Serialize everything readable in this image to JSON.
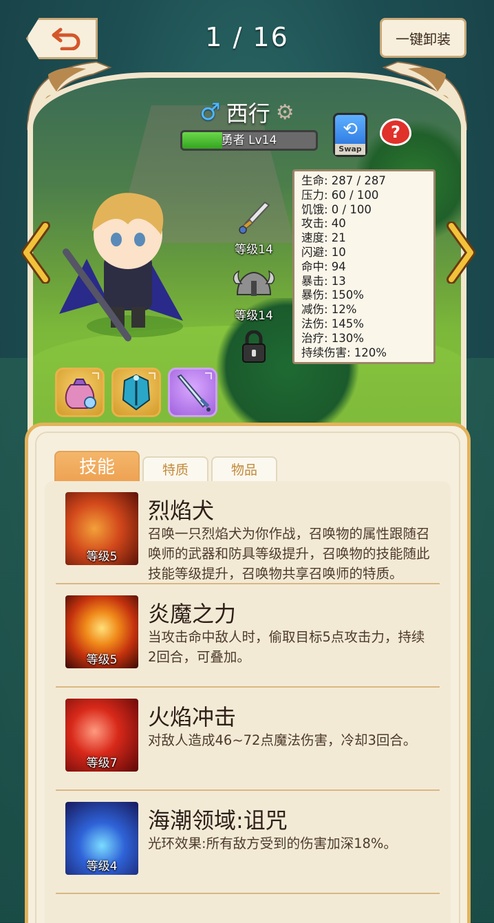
{
  "header": {
    "page_counter": "1 / 16",
    "unequip_all_label": "一键卸装"
  },
  "hero": {
    "gender_symbol": "♂",
    "name": "西行",
    "class_level": "勇者 Lv14",
    "level_progress": 0.3,
    "swap_label": "Swap",
    "help_label": "?"
  },
  "equipment": {
    "weapon_level": "等级14",
    "helmet_level": "等级14"
  },
  "stats": [
    "生命: 287 / 287",
    "压力: 60 / 100",
    "饥饿: 0 / 100",
    "攻击: 40",
    "速度: 21",
    "闪避: 10",
    "命中: 94",
    "暴击: 13",
    "暴伤: 150%",
    "减伤: 12%",
    "法伤: 145%",
    "治疗: 130%",
    "持续伤害: 120%"
  ],
  "tabs": {
    "skills": "技能",
    "traits": "特质",
    "items": "物品"
  },
  "skills": [
    {
      "title": "烈焰犬",
      "level": "等级5",
      "desc": "召唤一只烈焰犬为你作战，召唤物的属性跟随召唤师的武器和防具等级提升，召唤物的技能随此技能等级提升，召唤物共享召唤师的特质。"
    },
    {
      "title": "炎魔之力",
      "level": "等级5",
      "desc": "当攻击命中敌人时，偷取目标5点攻击力，持续2回合，可叠加。"
    },
    {
      "title": "火焰冲击",
      "level": "等级7",
      "desc": "对敌人造成46~72点魔法伤害，冷却3回合。"
    },
    {
      "title": "海潮领域:诅咒",
      "level": "等级4",
      "desc": "光环效果:所有敌方受到的伤害加深18%。"
    }
  ],
  "colors": {
    "accent": "#eea152",
    "panel_bg": "#f6efde",
    "level_bar": "#34a320"
  }
}
